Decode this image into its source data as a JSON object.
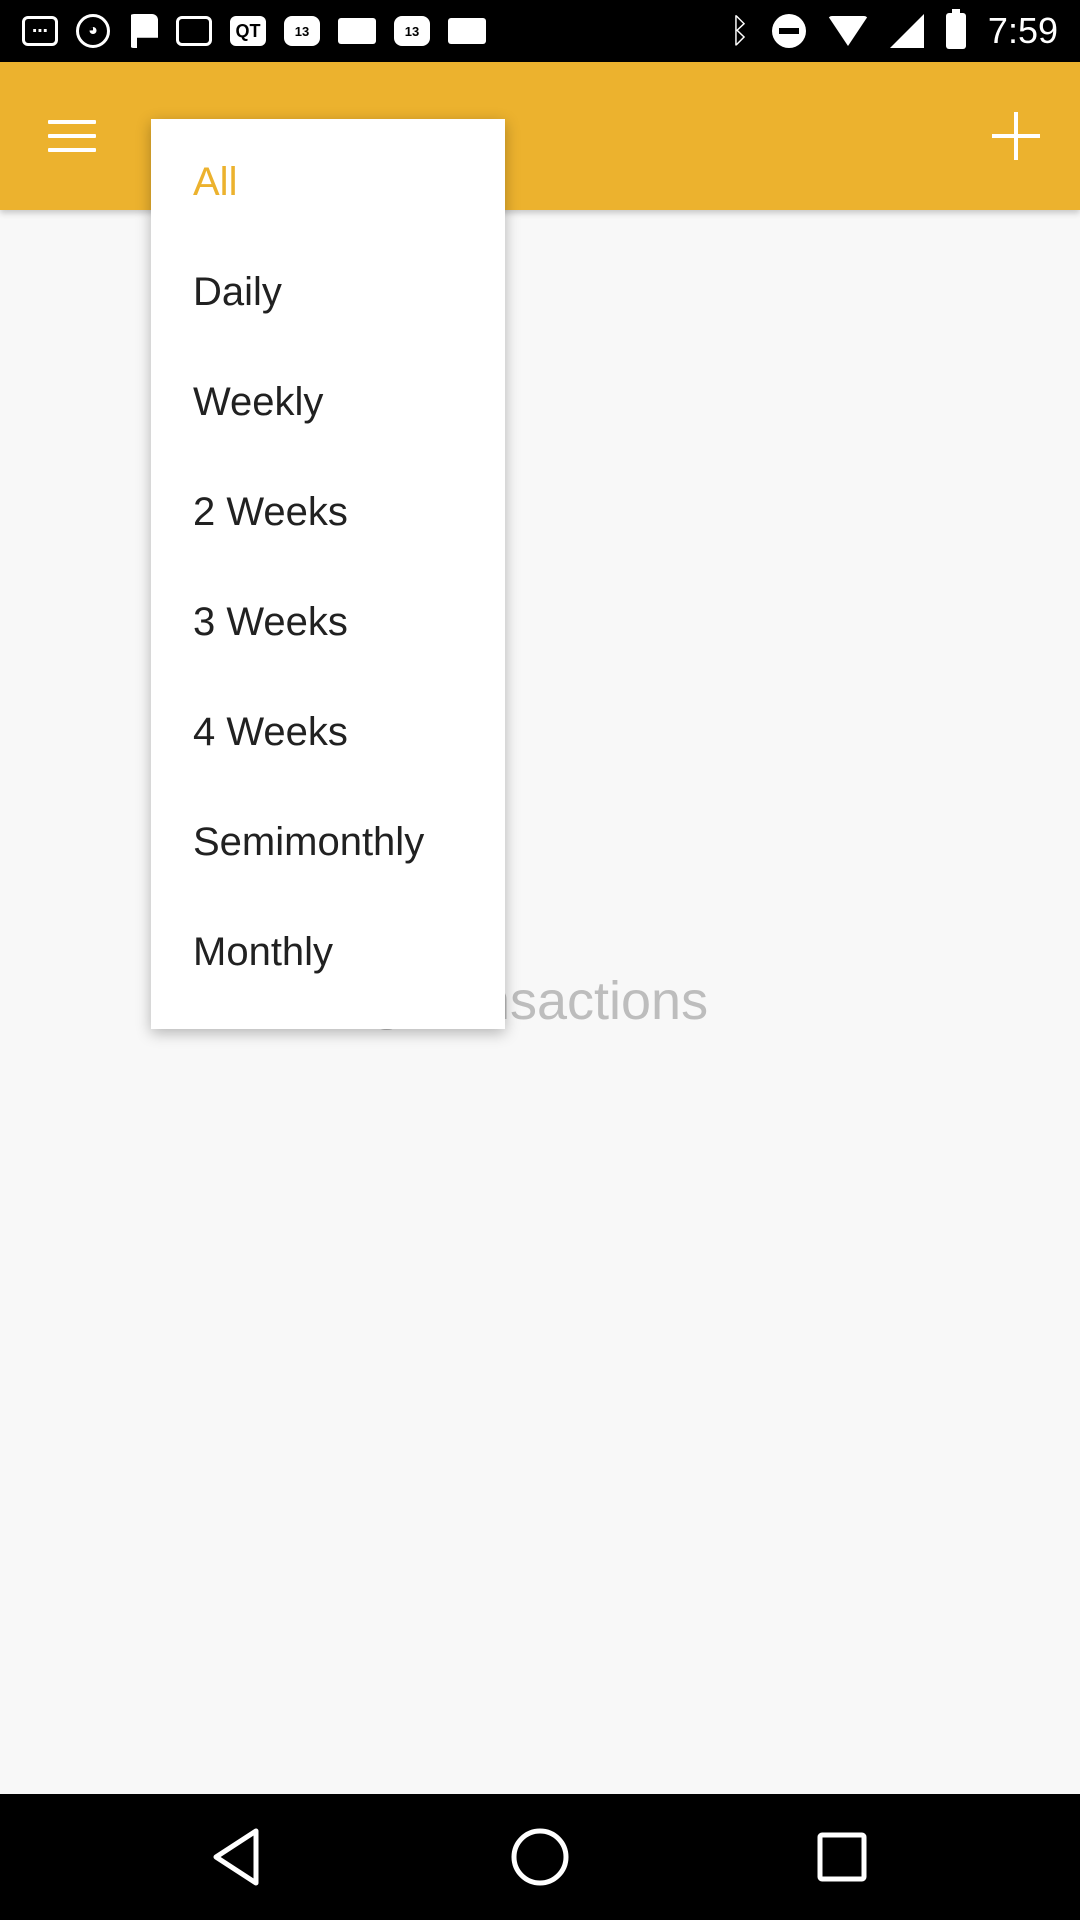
{
  "status_bar": {
    "icons_left": [
      "messages-icon",
      "game-icon",
      "flag-icon",
      "cast-icon",
      "qt-icon",
      "abc13-icon",
      "notification-icon",
      "abc13-icon",
      "window-icon"
    ],
    "qt_label": "QT",
    "badge_label": "13",
    "icons_right": [
      "bluetooth-icon",
      "do-not-disturb-icon",
      "wifi-icon",
      "signal-icon",
      "battery-icon"
    ],
    "time": "7:59"
  },
  "app_bar": {
    "color": "#ecb22e",
    "left_icon": "menu-icon",
    "right_icon": "add-icon"
  },
  "main": {
    "empty_text": "g transactions"
  },
  "dropdown": {
    "selected": "All",
    "selected_color": "#ecb22e",
    "items": [
      "All",
      "Daily",
      "Weekly",
      "2 Weeks",
      "3 Weeks",
      "4 Weeks",
      "Semimonthly",
      "Monthly"
    ]
  },
  "nav_bar": {
    "icons": [
      "back-icon",
      "home-icon",
      "recents-icon"
    ]
  }
}
